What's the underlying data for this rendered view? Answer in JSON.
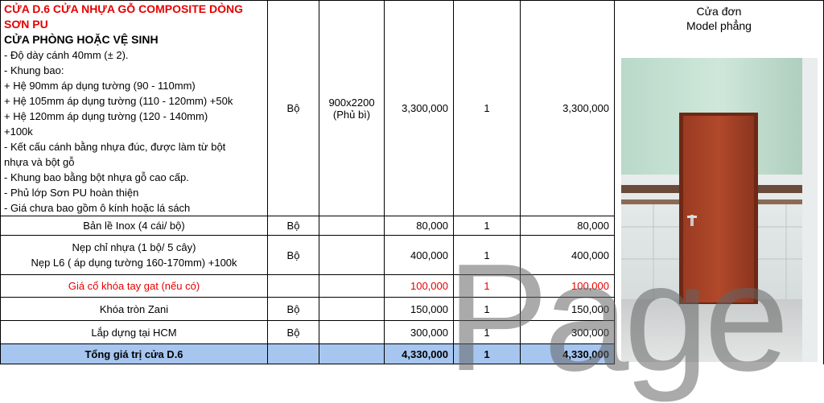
{
  "product": {
    "title_line1": "CỬA D.6 CỬA NHỰA GỖ COMPOSITE DÒNG",
    "title_line2": "SƠN PU",
    "subtitle": "CỬA PHÒNG HOẶC VỆ SINH",
    "spec_lines": [
      "- Độ dày cánh 40mm (± 2).",
      "- Khung bao:",
      "+ Hệ 90mm áp dụng tường (90 - 110mm)",
      "+ Hệ 105mm áp dụng tường (110 - 120mm) +50k",
      "+ Hệ 120mm áp dụng tường (120 - 140mm)",
      "+100k",
      "- Kết cấu cánh bằng nhựa đúc, được làm từ bột",
      "nhựa và bột gỗ",
      "- Khung bao bằng bột nhựa gỗ cao cấp.",
      "- Phủ lớp Sơn PU hoàn thiện",
      "- Giá chưa bao gồm ô kính hoặc lá sách"
    ],
    "unit": "Bộ",
    "size_line1": "900x2200",
    "size_line2": "(Phủ bì)",
    "price": "3,300,000",
    "qty": "1",
    "amount": "3,300,000"
  },
  "image_caption": {
    "line1": "Cửa đơn",
    "line2": "Model phẳng"
  },
  "rows": [
    {
      "desc": [
        "Bản lề Inox  (4 cái/ bộ)"
      ],
      "unit": "Bộ",
      "price": "80,000",
      "qty": "1",
      "amount": "80,000",
      "red": false
    },
    {
      "desc": [
        "Nẹp chỉ nhựa (1 bộ/ 5 cây)",
        "Nẹp L6 ( áp dụng tường 160-170mm) +100k"
      ],
      "unit": "Bộ",
      "price": "400,000",
      "qty": "1",
      "amount": "400,000",
      "red": false
    },
    {
      "desc": [
        "Giá cổ khóa tay gat (nếu có)"
      ],
      "unit": "",
      "price": "100,000",
      "qty": "1",
      "amount": "100,000",
      "red": true
    },
    {
      "desc": [
        "Khóa tròn Zani"
      ],
      "unit": "Bộ",
      "price": "150,000",
      "qty": "1",
      "amount": "150,000",
      "red": false
    },
    {
      "desc": [
        "Lắp dựng tại HCM"
      ],
      "unit": "Bộ",
      "price": "300,000",
      "qty": "1",
      "amount": "300,000",
      "red": false
    }
  ],
  "total": {
    "label": "Tổng giá trị cửa D.6",
    "price": "4,330,000",
    "qty": "1",
    "amount": "4,330,000"
  },
  "watermark": "Page",
  "colors": {
    "red_text": "#e60000",
    "total_fill": "#a6c6f0"
  }
}
